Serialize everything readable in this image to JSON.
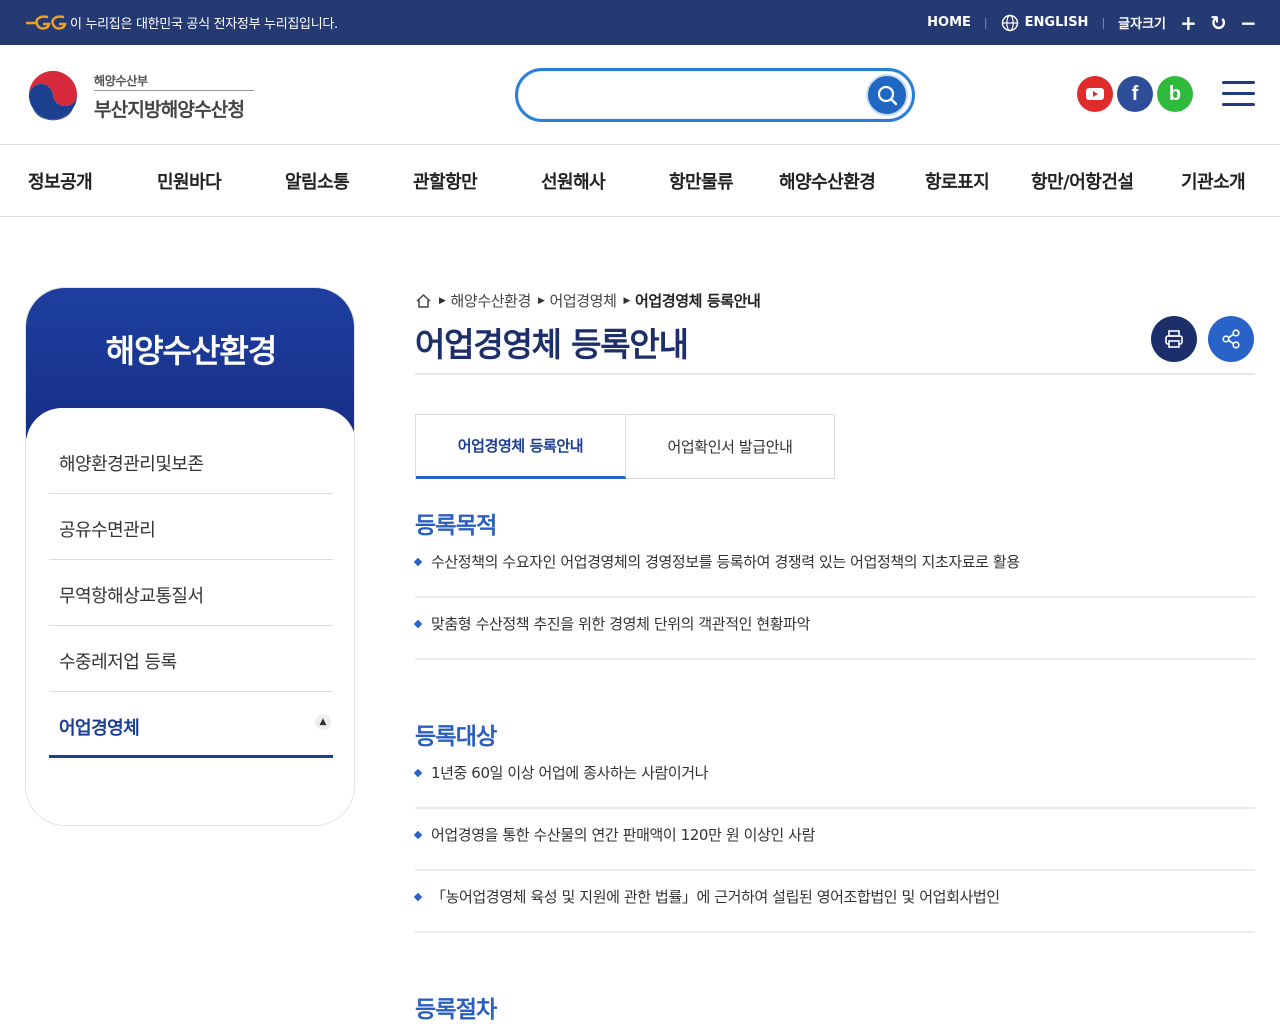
{
  "gov_banner": {
    "logo_icon": "egov-logo-icon",
    "text": "이 누리집은 대한민국 공식 전자정부 누리집입니다.",
    "home": "HOME",
    "english": "ENGLISH",
    "font_size_label": "글자크기",
    "plus": "+",
    "reset": "↻",
    "minus": "−"
  },
  "header": {
    "org_sub": "해양수산부",
    "org_main": "부산지방해양수산청",
    "search_placeholder": "",
    "sns": [
      "youtube-icon",
      "facebook-icon",
      "blog-icon"
    ],
    "blog_letter": "b",
    "facebook_letter": "f"
  },
  "gnb": [
    "정보공개",
    "민원바다",
    "알림소통",
    "관할항만",
    "선원해사",
    "항만물류",
    "해양수산환경",
    "항로표지",
    "항만/어항건설",
    "기관소개"
  ],
  "sidebar": {
    "title": "해양수산환경",
    "items": [
      {
        "label": "해양환경관리및보존"
      },
      {
        "label": "공유수면관리"
      },
      {
        "label": "무역항해상교통질서"
      },
      {
        "label": "수중레저업 등록"
      },
      {
        "label": "어업경영체"
      }
    ]
  },
  "breadcrumb": {
    "items": [
      "해양수산환경",
      "어업경영체",
      "어업경영체 등록안내"
    ]
  },
  "page_title": "어업경영체 등록안내",
  "tabs": [
    "어업경영체 등록안내",
    "어업확인서 발급안내"
  ],
  "sections": [
    {
      "title": "등록목적",
      "bullets": [
        "수산정책의 수요자인 어업경영체의 경영정보를 등록하여 경쟁력 있는 어업정책의 지초자료로 활용",
        "맞춤형 수산정책 추진을 위한 경영체 단위의 객관적인 현황파악"
      ]
    },
    {
      "title": "등록대상",
      "bullets": [
        "1년중 60일 이상 어업에 종사하는 사람이거나",
        "어업경영을 통한 수산물의 연간 판매액이 120만 원 이상인 사람",
        "「농어업경영체 육성 및 지원에 관한 법률」에 근거하여 설립된 영어조합법인 및 어업회사법인"
      ]
    },
    {
      "title": "등록절차",
      "bullets": []
    }
  ],
  "colors": {
    "gov_bar": "#253a73",
    "brand_navy": "#1c2f6b",
    "accent_blue": "#2a63c8"
  }
}
